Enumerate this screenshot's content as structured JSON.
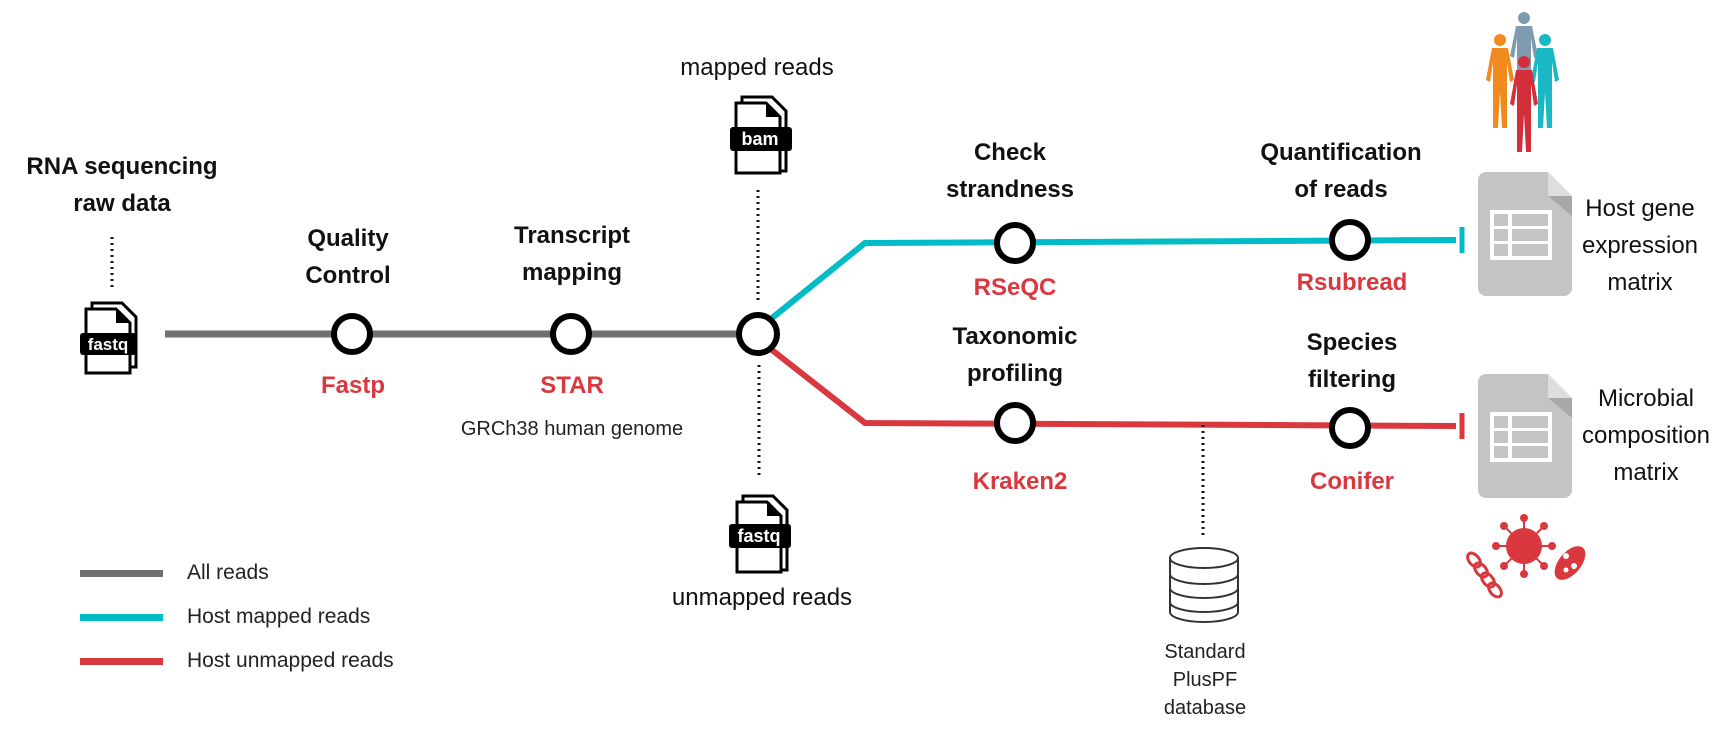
{
  "colors": {
    "all_reads": "#707070",
    "host_mapped": "#00bcc6",
    "host_unmapped": "#d9383e",
    "node_stroke": "#000000",
    "tool_text": "#d9383e",
    "matrix_icon": "#c4c4c4"
  },
  "source": {
    "label": "RNA sequencing\nraw data",
    "icon": "fastq-file-icon",
    "icon_text": "fastq"
  },
  "steps": [
    {
      "id": "qc",
      "title": "Quality\nControl",
      "tool": "Fastp",
      "note": ""
    },
    {
      "id": "mapping",
      "title": "Transcript\nmapping",
      "tool": "STAR",
      "note": "GRCh38 human genome"
    },
    {
      "id": "strand",
      "title": "Check\nstrandness",
      "tool": "RSeQC",
      "note": ""
    },
    {
      "id": "quant",
      "title": "Quantification\nof reads",
      "tool": "Rsubread",
      "note": ""
    },
    {
      "id": "taxo",
      "title": "Taxonomic\nprofiling",
      "tool": "Kraken2",
      "note": ""
    },
    {
      "id": "species",
      "title": "Species\nfiltering",
      "tool": "Conifer",
      "note": ""
    }
  ],
  "junction": {
    "mapped": {
      "label": "mapped reads",
      "icon": "bam-file-icon",
      "icon_text": "bam"
    },
    "unmapped": {
      "label": "unmapped reads",
      "icon": "fastq-file-icon",
      "icon_text": "fastq"
    }
  },
  "database": {
    "label": "Standard\nPlusPF\ndatabase",
    "icon": "database-icon"
  },
  "outputs": [
    {
      "id": "host",
      "label": "Host gene\nexpression\nmatrix",
      "icon": "spreadsheet-icon",
      "illustration": "human-figures-icon"
    },
    {
      "id": "microbial",
      "label": "Microbial\ncomposition\nmatrix",
      "icon": "spreadsheet-icon",
      "illustration": "microbes-icon"
    }
  ],
  "legend": [
    {
      "label": "All reads",
      "color_key": "all_reads"
    },
    {
      "label": "Host mapped reads",
      "color_key": "host_mapped"
    },
    {
      "label": "Host unmapped reads",
      "color_key": "host_unmapped"
    }
  ]
}
